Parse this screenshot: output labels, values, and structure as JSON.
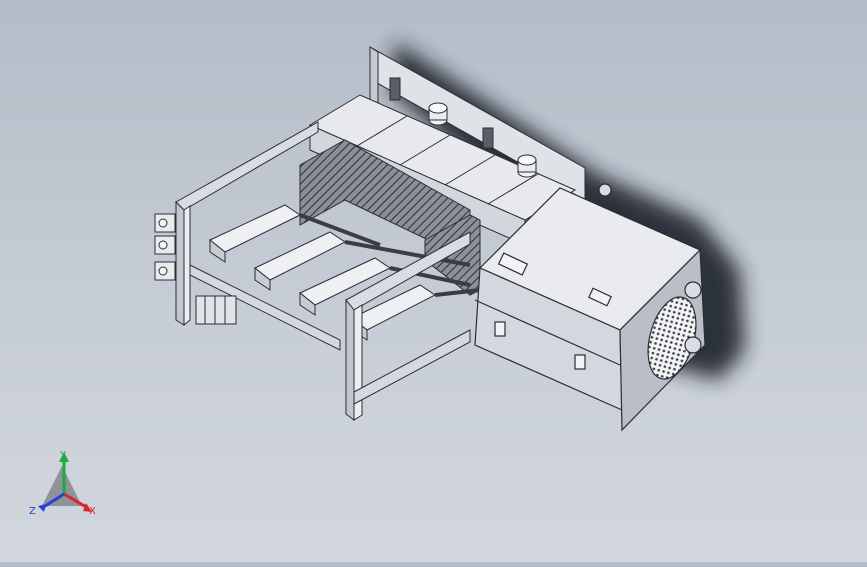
{
  "triad": {
    "x_label": "X",
    "y_label": "Y",
    "z_label": "Z",
    "x_color": "#d8262c",
    "y_color": "#1faa3c",
    "z_color": "#2a3fd6"
  },
  "colors": {
    "background_top": "#b4bcc7",
    "background_bottom": "#d2d7de",
    "part_light": "#eef0f4",
    "part_mid": "#d9dde3",
    "part_dark": "#b9bec7",
    "edge": "#2a2d33",
    "shadow": "#1f232a"
  },
  "icons": [
    "coordinate-triad-icon"
  ]
}
